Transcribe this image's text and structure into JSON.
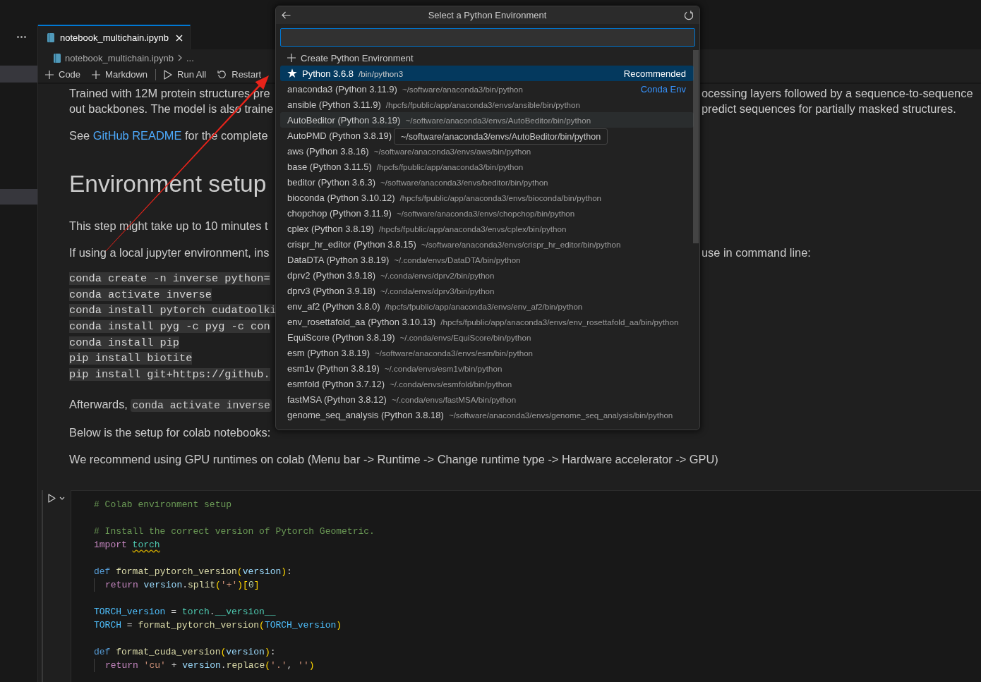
{
  "sidebar": {
    "rows": [
      {
        "selected": true
      },
      {
        "selected": true
      }
    ]
  },
  "tabs": [
    {
      "label": "notebook_multichain.ipynb",
      "selected": true
    }
  ],
  "breadcrumb": [
    {
      "kind": "file",
      "label": "notebook_multichain.ipynb"
    },
    {
      "kind": "more",
      "label": "..."
    }
  ],
  "toolbar": {
    "groups": [
      [
        {
          "kind": "add",
          "label": "Code"
        },
        {
          "kind": "add",
          "label": "Markdown"
        }
      ],
      [
        {
          "kind": "run_all",
          "label": "Run All"
        },
        {
          "kind": "restart",
          "label": "Restart"
        }
      ]
    ]
  },
  "markdown": {
    "blocks": [
      {
        "kind": "paragraph",
        "lines": [
          {
            "segments": [
              {
                "kind": "text",
                "text": "Trained with 12M protein structures pre"
              }
            ],
            "right": "ocessing layers followed by a sequence-to-sequence"
          },
          {
            "segments": [
              {
                "kind": "text",
                "text": "out backbones. The model is also traine"
              }
            ],
            "right": "predict sequences for partially masked structures."
          }
        ]
      },
      {
        "kind": "paragraph",
        "lines": [
          {
            "segments": [
              {
                "kind": "text",
                "text": "See "
              },
              {
                "kind": "link",
                "text": "GitHub README"
              },
              {
                "kind": "text",
                "text": " for the complete"
              }
            ]
          }
        ]
      },
      {
        "kind": "heading",
        "lines": [
          {
            "segments": [
              {
                "kind": "text",
                "text": "Environment setup"
              }
            ]
          }
        ]
      },
      {
        "kind": "paragraph",
        "lines": [
          {
            "segments": [
              {
                "kind": "text",
                "text": "This step might take up to 10 minutes t"
              }
            ]
          }
        ]
      },
      {
        "kind": "paragraph",
        "lines": [
          {
            "segments": [
              {
                "kind": "text",
                "text": "If using a local jupyter environment, ins"
              }
            ],
            "right": "use in command line:"
          }
        ]
      },
      {
        "kind": "code",
        "lines": [
          {
            "segments": [
              {
                "kind": "text",
                "text": "conda create -n inverse python="
              }
            ]
          },
          {
            "segments": [
              {
                "kind": "text",
                "text": "conda activate inverse"
              }
            ]
          },
          {
            "segments": [
              {
                "kind": "text",
                "text": "conda install pytorch cudatoolki"
              }
            ]
          },
          {
            "segments": [
              {
                "kind": "text",
                "text": "conda install pyg -c pyg -c con"
              }
            ]
          },
          {
            "segments": [
              {
                "kind": "text",
                "text": "conda install pip"
              }
            ]
          },
          {
            "segments": [
              {
                "kind": "text",
                "text": "pip install biotite"
              }
            ]
          },
          {
            "segments": [
              {
                "kind": "text",
                "text": "pip install git+https://github."
              }
            ]
          }
        ]
      },
      {
        "kind": "paragraph",
        "lines": [
          {
            "segments": [
              {
                "kind": "text",
                "text": "Afterwards, "
              },
              {
                "kind": "code",
                "text": "conda activate inverse"
              }
            ]
          }
        ]
      },
      {
        "kind": "paragraph",
        "lines": [
          {
            "segments": [
              {
                "kind": "text",
                "text": "Below is the setup for colab notebooks:"
              }
            ]
          }
        ]
      },
      {
        "kind": "paragraph",
        "lines": [
          {
            "segments": [
              {
                "kind": "text",
                "text": "We recommend using GPU runtimes on colab (Menu bar -> Runtime -> Change runtime type -> Hardware accelerator -> GPU)"
              }
            ]
          }
        ]
      }
    ]
  },
  "code_cell": {
    "blocks": [
      [
        {
          "tokens": [
            {
              "kind": "comment",
              "text": "# Colab environment setup"
            }
          ]
        }
      ],
      [
        {
          "tokens": [
            {
              "kind": "comment",
              "text": "# Install the correct version of Pytorch Geometric."
            }
          ]
        },
        {
          "tokens": [
            {
              "kind": "control",
              "text": "import "
            },
            {
              "kind": "module",
              "text": "torch",
              "warning": true
            }
          ]
        }
      ],
      [
        {
          "tokens": [
            {
              "kind": "keyword",
              "text": "def "
            },
            {
              "kind": "function",
              "text": "format_pytorch_version"
            },
            {
              "kind": "bracket",
              "text": "("
            },
            {
              "kind": "variable",
              "text": "version"
            },
            {
              "kind": "bracket",
              "text": ")"
            },
            {
              "kind": "plain",
              "text": ":"
            }
          ],
          "children": [
            {
              "tokens": [
                {
                  "kind": "control",
                  "text": "return "
                },
                {
                  "kind": "variable",
                  "text": "version"
                },
                {
                  "kind": "plain",
                  "text": "."
                },
                {
                  "kind": "function",
                  "text": "split"
                },
                {
                  "kind": "bracket",
                  "text": "("
                },
                {
                  "kind": "string",
                  "text": "'+'"
                },
                {
                  "kind": "bracket",
                  "text": ")"
                },
                {
                  "kind": "bracket",
                  "text": "["
                },
                {
                  "kind": "number",
                  "text": "0"
                },
                {
                  "kind": "bracket",
                  "text": "]"
                }
              ]
            }
          ]
        }
      ],
      [
        {
          "tokens": [
            {
              "kind": "constant",
              "text": "TORCH_version"
            },
            {
              "kind": "plain",
              "text": " = "
            },
            {
              "kind": "module",
              "text": "torch"
            },
            {
              "kind": "plain",
              "text": "."
            },
            {
              "kind": "module",
              "text": "__version__"
            }
          ]
        },
        {
          "tokens": [
            {
              "kind": "constant",
              "text": "TORCH"
            },
            {
              "kind": "plain",
              "text": " = "
            },
            {
              "kind": "function",
              "text": "format_pytorch_version"
            },
            {
              "kind": "bracket",
              "text": "("
            },
            {
              "kind": "constant",
              "text": "TORCH_version"
            },
            {
              "kind": "bracket",
              "text": ")"
            }
          ]
        }
      ],
      [
        {
          "tokens": [
            {
              "kind": "keyword",
              "text": "def "
            },
            {
              "kind": "function",
              "text": "format_cuda_version"
            },
            {
              "kind": "bracket",
              "text": "("
            },
            {
              "kind": "variable",
              "text": "version"
            },
            {
              "kind": "bracket",
              "text": ")"
            },
            {
              "kind": "plain",
              "text": ":"
            }
          ],
          "children": [
            {
              "tokens": [
                {
                  "kind": "control",
                  "text": "return "
                },
                {
                  "kind": "string",
                  "text": "'cu'"
                },
                {
                  "kind": "plain",
                  "text": " + "
                },
                {
                  "kind": "variable",
                  "text": "version"
                },
                {
                  "kind": "plain",
                  "text": "."
                },
                {
                  "kind": "function",
                  "text": "replace"
                },
                {
                  "kind": "bracket",
                  "text": "("
                },
                {
                  "kind": "string",
                  "text": "'.'"
                },
                {
                  "kind": "plain",
                  "text": ", "
                },
                {
                  "kind": "string",
                  "text": "''"
                },
                {
                  "kind": "bracket",
                  "text": ")"
                }
              ]
            }
          ]
        }
      ]
    ]
  },
  "quick_pick": {
    "title": "Select a Python Environment",
    "items": [
      {
        "kind": "create",
        "label": "Create Python Environment",
        "selected": false,
        "hovered": false
      },
      {
        "kind": "starred",
        "label": "Python 3.6.8",
        "description": "/bin/python3",
        "tag": "Recommended",
        "selected": true,
        "hovered": false
      },
      {
        "kind": "environment",
        "label": "anaconda3 (Python 3.11.9)",
        "description": "~/software/anaconda3/bin/python",
        "tag": "Conda Env",
        "selected": false,
        "hovered": false
      },
      {
        "kind": "environment",
        "label": "ansible (Python 3.11.9)",
        "description": "/hpcfs/fpublic/app/anaconda3/envs/ansible/bin/python",
        "selected": false,
        "hovered": false
      },
      {
        "kind": "environment",
        "label": "AutoBeditor (Python 3.8.19)",
        "description": "~/software/anaconda3/envs/AutoBeditor/bin/python",
        "selected": false,
        "hovered": true
      },
      {
        "kind": "environment",
        "label": "AutoPMD (Python 3.8.19)",
        "selected": false,
        "hovered": false
      },
      {
        "kind": "environment",
        "label": "aws (Python 3.8.16)",
        "description": "~/software/anaconda3/envs/aws/bin/python",
        "selected": false,
        "hovered": false
      },
      {
        "kind": "environment",
        "label": "base (Python 3.11.5)",
        "description": "/hpcfs/fpublic/app/anaconda3/bin/python",
        "selected": false,
        "hovered": false
      },
      {
        "kind": "environment",
        "label": "beditor (Python 3.6.3)",
        "description": "~/software/anaconda3/envs/beditor/bin/python",
        "selected": false,
        "hovered": false
      },
      {
        "kind": "environment",
        "label": "bioconda (Python 3.10.12)",
        "description": "/hpcfs/fpublic/app/anaconda3/envs/bioconda/bin/python",
        "selected": false,
        "hovered": false
      },
      {
        "kind": "environment",
        "label": "chopchop (Python 3.11.9)",
        "description": "~/software/anaconda3/envs/chopchop/bin/python",
        "selected": false,
        "hovered": false
      },
      {
        "kind": "environment",
        "label": "cplex (Python 3.8.19)",
        "description": "/hpcfs/fpublic/app/anaconda3/envs/cplex/bin/python",
        "selected": false,
        "hovered": false
      },
      {
        "kind": "environment",
        "label": "crispr_hr_editor (Python 3.8.15)",
        "description": "~/software/anaconda3/envs/crispr_hr_editor/bin/python",
        "selected": false,
        "hovered": false
      },
      {
        "kind": "environment",
        "label": "DataDTA (Python 3.8.19)",
        "description": "~/.conda/envs/DataDTA/bin/python",
        "selected": false,
        "hovered": false
      },
      {
        "kind": "environment",
        "label": "dprv2 (Python 3.9.18)",
        "description": "~/.conda/envs/dprv2/bin/python",
        "selected": false,
        "hovered": false
      },
      {
        "kind": "environment",
        "label": "dprv3 (Python 3.9.18)",
        "description": "~/.conda/envs/dprv3/bin/python",
        "selected": false,
        "hovered": false
      },
      {
        "kind": "environment",
        "label": "env_af2 (Python 3.8.0)",
        "description": "/hpcfs/fpublic/app/anaconda3/envs/env_af2/bin/python",
        "selected": false,
        "hovered": false
      },
      {
        "kind": "environment",
        "label": "env_rosettafold_aa (Python 3.10.13)",
        "description": "/hpcfs/fpublic/app/anaconda3/envs/env_rosettafold_aa/bin/python",
        "selected": false,
        "hovered": false
      },
      {
        "kind": "environment",
        "label": "EquiScore (Python 3.8.19)",
        "description": "~/.conda/envs/EquiScore/bin/python",
        "selected": false,
        "hovered": false
      },
      {
        "kind": "environment",
        "label": "esm (Python 3.8.19)",
        "description": "~/software/anaconda3/envs/esm/bin/python",
        "selected": false,
        "hovered": false
      },
      {
        "kind": "environment",
        "label": "esm1v (Python 3.8.19)",
        "description": "~/.conda/envs/esm1v/bin/python",
        "selected": false,
        "hovered": false
      },
      {
        "kind": "environment",
        "label": "esmfold (Python 3.7.12)",
        "description": "~/.conda/envs/esmfold/bin/python",
        "selected": false,
        "hovered": false
      },
      {
        "kind": "environment",
        "label": "fastMSA (Python 3.8.12)",
        "description": "~/.conda/envs/fastMSA/bin/python",
        "selected": false,
        "hovered": false
      },
      {
        "kind": "environment",
        "label": "genome_seq_analysis (Python 3.8.18)",
        "description": "~/software/anaconda3/envs/genome_seq_analysis/bin/python",
        "selected": false,
        "hovered": false
      }
    ],
    "tooltip": "~/software/anaconda3/envs/AutoBeditor/bin/python"
  }
}
